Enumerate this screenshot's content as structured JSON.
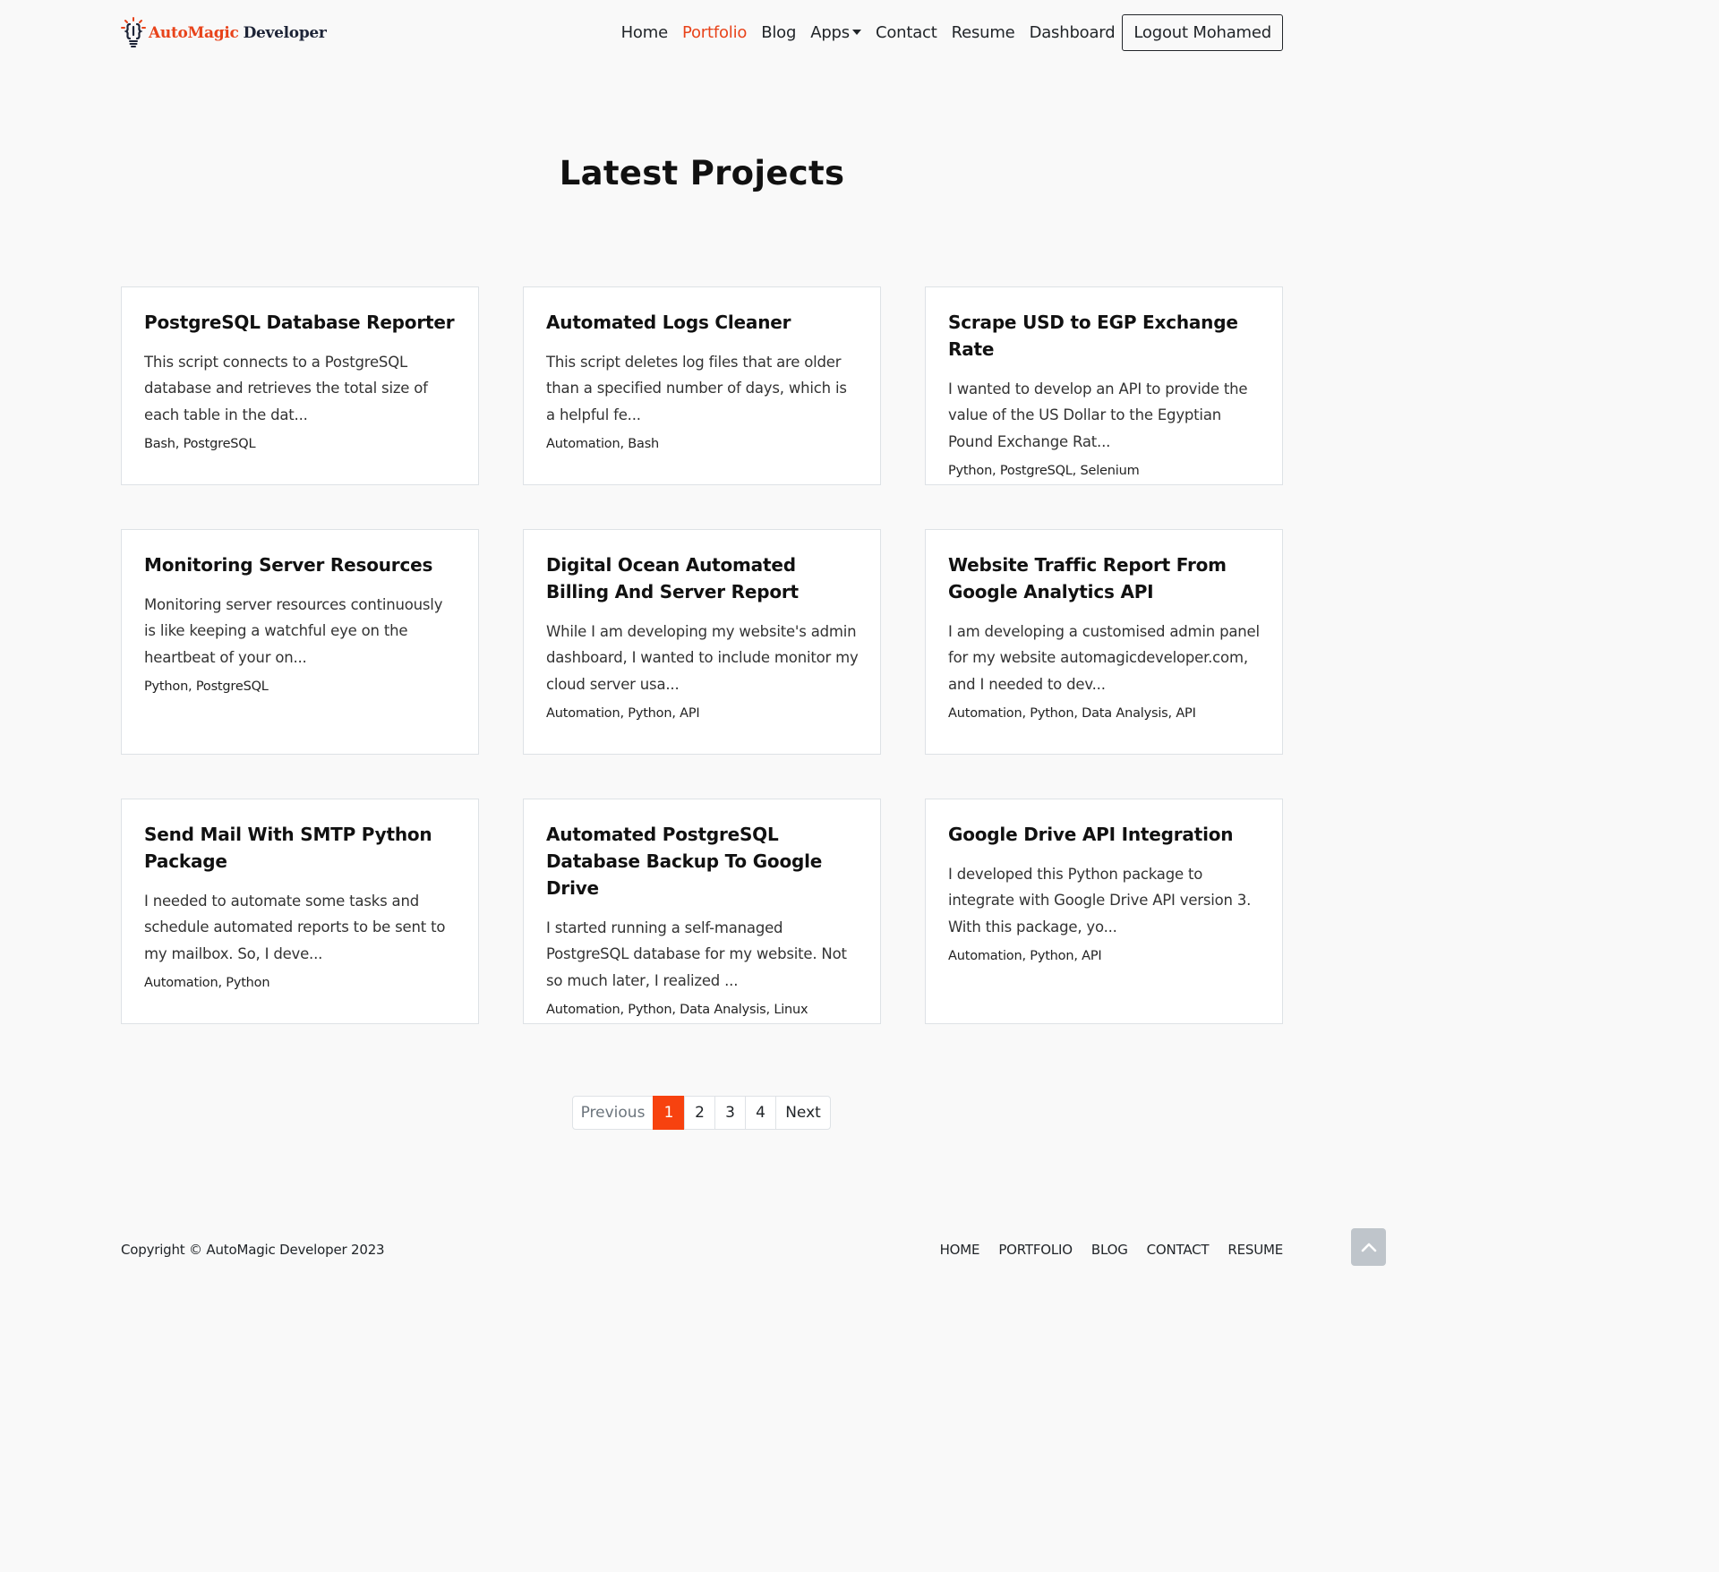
{
  "brand": {
    "part1": "AutoMagic",
    "part2": "Developer",
    "icon": "lightbulb-code-icon"
  },
  "nav": {
    "items": [
      {
        "label": "Home",
        "active": false
      },
      {
        "label": "Portfolio",
        "active": true
      },
      {
        "label": "Blog",
        "active": false
      },
      {
        "label": "Apps",
        "active": false
      },
      {
        "label": "Contact",
        "active": false
      },
      {
        "label": "Resume",
        "active": false
      },
      {
        "label": "Dashboard",
        "active": false
      }
    ],
    "logout_label": "Logout Mohamed"
  },
  "page_title": "Latest Projects",
  "projects": [
    {
      "title": "PostgreSQL Database Reporter",
      "excerpt": "This script connects to a PostgreSQL database and retrieves the total size of each table in the dat...",
      "tags": "Bash, PostgreSQL"
    },
    {
      "title": "Automated Logs Cleaner",
      "excerpt": "This script deletes log files that are older than a specified number of days, which is a helpful fe...",
      "tags": "Automation, Bash"
    },
    {
      "title": "Scrape USD to EGP Exchange Rate",
      "excerpt": "I wanted to develop an API to provide the value of the US Dollar to the Egyptian Pound Exchange Rat...",
      "tags": "Python, PostgreSQL, Selenium"
    },
    {
      "title": "Monitoring Server Resources",
      "excerpt": "Monitoring server resources continuously is like keeping a watchful eye on the heartbeat of your on...",
      "tags": "Python, PostgreSQL"
    },
    {
      "title": "Digital Ocean Automated Billing And Server Report",
      "excerpt": "While I am developing my website's admin dashboard, I wanted to include monitor my cloud server usa...",
      "tags": "Automation, Python, API"
    },
    {
      "title": "Website Traffic Report From Google Analytics API",
      "excerpt": "I am developing a customised admin panel for my website automagicdeveloper.com, and I needed to dev...",
      "tags": "Automation, Python, Data Analysis, API"
    },
    {
      "title": "Send Mail With SMTP Python Package",
      "excerpt": "I needed to automate some tasks and schedule automated reports to be sent to my mailbox. So, I deve...",
      "tags": "Automation, Python"
    },
    {
      "title": "Automated PostgreSQL Database Backup To Google Drive",
      "excerpt": "I started running a self-managed PostgreSQL database for my website. Not so much later, I realized ...",
      "tags": "Automation, Python, Data Analysis, Linux"
    },
    {
      "title": "Google Drive API Integration",
      "excerpt": "I developed this Python package to integrate with Google Drive API version 3. With this package, yo...",
      "tags": "Automation, Python, API"
    }
  ],
  "pagination": {
    "previous_label": "Previous",
    "pages": [
      "1",
      "2",
      "3",
      "4"
    ],
    "current": "1",
    "next_label": "Next"
  },
  "footer": {
    "copyright": "Copyright © AutoMagic Developer 2023",
    "links": [
      "HOME",
      "PORTFOLIO",
      "BLOG",
      "CONTACT",
      "RESUME"
    ],
    "back_to_top_icon": "chevron-up-icon"
  },
  "colors": {
    "accent": "#e8431a",
    "active_page": "#f7420f",
    "page_bg": "#f9f9f9"
  }
}
